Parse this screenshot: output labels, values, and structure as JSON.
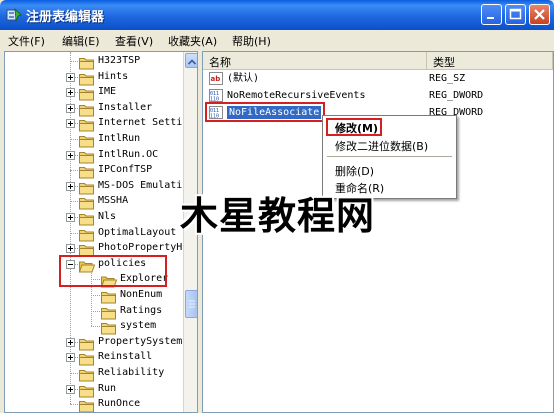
{
  "window": {
    "title": "注册表编辑器",
    "icon": "regedit-icon"
  },
  "menubar": {
    "items": [
      "文件(F)",
      "编辑(E)",
      "查看(V)",
      "收藏夹(A)",
      "帮助(H)"
    ]
  },
  "tree": {
    "nodes": [
      {
        "label": "H323TSP",
        "expander": "none"
      },
      {
        "label": "Hints",
        "expander": "plus"
      },
      {
        "label": "IME",
        "expander": "plus"
      },
      {
        "label": "Installer",
        "expander": "plus"
      },
      {
        "label": "Internet Setti",
        "expander": "plus"
      },
      {
        "label": "IntlRun",
        "expander": "none"
      },
      {
        "label": "IntlRun.OC",
        "expander": "plus"
      },
      {
        "label": "IPConfTSP",
        "expander": "none"
      },
      {
        "label": "MS-DOS Emulati",
        "expander": "plus"
      },
      {
        "label": "MSSHA",
        "expander": "none"
      },
      {
        "label": "Nls",
        "expander": "plus"
      },
      {
        "label": "OptimalLayout",
        "expander": "none"
      },
      {
        "label": "PhotoPropertyH",
        "expander": "plus"
      },
      {
        "label": "policies",
        "expander": "minus"
      },
      {
        "label": "Explorer",
        "expander": "none"
      },
      {
        "label": "NonEnum",
        "expander": "none"
      },
      {
        "label": "Ratings",
        "expander": "none"
      },
      {
        "label": "system",
        "expander": "none"
      },
      {
        "label": "PropertySystem",
        "expander": "plus"
      },
      {
        "label": "Reinstall",
        "expander": "plus"
      },
      {
        "label": "Reliability",
        "expander": "none"
      },
      {
        "label": "Run",
        "expander": "plus"
      },
      {
        "label": "RunOnce",
        "expander": "none"
      }
    ]
  },
  "list": {
    "columns": {
      "name": "名称",
      "type": "类型"
    },
    "rows": [
      {
        "name": "(默认)",
        "type": "REG_SZ",
        "icon": "string-value-icon"
      },
      {
        "name": "NoRemoteRecursiveEvents",
        "type": "REG_DWORD",
        "icon": "binary-value-icon"
      },
      {
        "name": "NoFileAssociate",
        "type": "REG_DWORD",
        "icon": "binary-value-icon"
      }
    ]
  },
  "context_menu": {
    "items": [
      "修改(M)",
      "修改二进位数据(B)",
      "删除(D)",
      "重命名(R)"
    ]
  },
  "watermark": {
    "text": "木星教程网"
  },
  "colors": {
    "title_bar": "#1e68e0",
    "highlight_box": "#d42020",
    "selection": "#316ac5"
  }
}
